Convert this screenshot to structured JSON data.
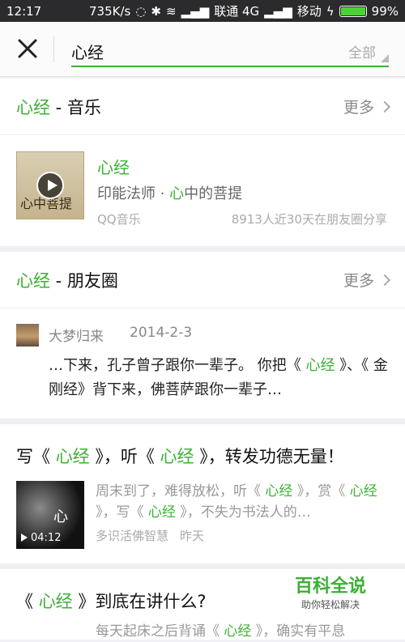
{
  "status": {
    "time": "12:17",
    "speed": "735K/s",
    "carrier1": "联通 4G",
    "carrier2": "移动",
    "battery": "99%"
  },
  "search": {
    "query": "心经",
    "scope": "全部"
  },
  "music_section": {
    "keyword": "心经",
    "heading_suffix": " - 音乐",
    "more_label": "更多",
    "item": {
      "title": "心经",
      "artist_prefix": "印能法师 · ",
      "artist_highlight": "心",
      "artist_suffix": "中的菩提",
      "source": "QQ音乐",
      "share_stat": "8913人近30天在朋友圈分享",
      "cover_text": "心中菩提"
    }
  },
  "moments_section": {
    "keyword": "心经",
    "heading_suffix": " - 朋友圈",
    "more_label": "更多",
    "post": {
      "user": "大梦归来",
      "date": "2014-2-3",
      "text_1": "…下来，孔子曾子跟你一辈子。 你把《 ",
      "text_hl_1": "心经",
      "text_2": " 》、《 金刚经》背下来，佛菩萨跟你一辈子…"
    }
  },
  "article_1": {
    "title_1": "写《 ",
    "title_hl_1": "心经",
    "title_2": " 》，听《 ",
    "title_hl_2": "心经",
    "title_3": " 》，转发功德无量！",
    "summary_1": "周末到了，难得放松，听《 ",
    "summary_hl_1": "心经",
    "summary_2": " 》，赏《 ",
    "summary_hl_2": "心经",
    "summary_3": " 》，写《 ",
    "summary_hl_3": "心经",
    "summary_4": " 》，不失为书法人的…",
    "source": "多识活佛智慧",
    "time": "昨天",
    "duration": "04:12",
    "thumb_text": "心"
  },
  "article_2": {
    "title_1": "《 ",
    "title_hl_1": "心经",
    "title_2": " 》到底在讲什么?",
    "summary_1": "每天起床之后背诵《 ",
    "summary_hl_1": "心经",
    "summary_2": " 》，确实有平息"
  },
  "watermark": {
    "title": "百科全说",
    "subtitle": "助你轻松解决"
  }
}
